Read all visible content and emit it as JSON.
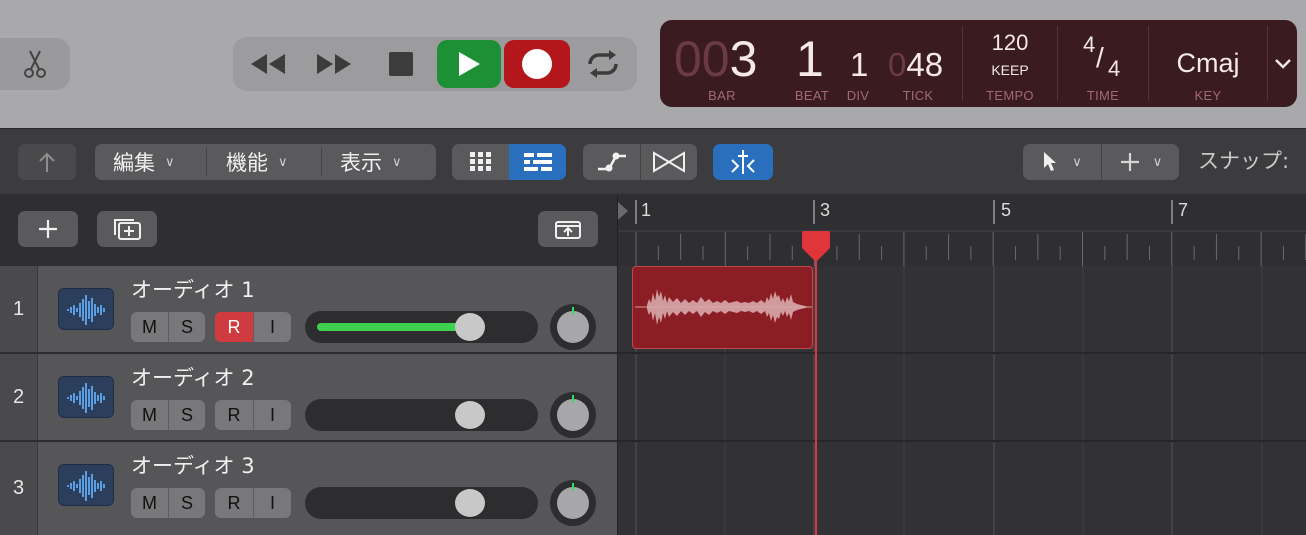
{
  "control_bar": {
    "lcd": {
      "bar_prefix": "00",
      "bar": "3",
      "beat": "1",
      "div": "1",
      "tick_prefix": "0",
      "tick": "48",
      "tempo": "120",
      "tempo_mode": "KEEP",
      "time_num": "4",
      "time_den": "4",
      "key": "Cmaj",
      "labels": {
        "bar": "BAR",
        "beat": "BEAT",
        "div": "DIV",
        "tick": "TICK",
        "tempo": "TEMPO",
        "time": "TIME",
        "key": "KEY"
      }
    },
    "colors": {
      "play": "#1d8f35",
      "record": "#b3171c",
      "lcd_bg": "#3a1c20"
    }
  },
  "toolbar": {
    "menus": [
      {
        "label": "編集"
      },
      {
        "label": "機能"
      },
      {
        "label": "表示"
      }
    ],
    "snap_label": "スナップ:"
  },
  "ruler": {
    "bar_labels": [
      "1",
      "3",
      "5",
      "7"
    ]
  },
  "tracks": [
    {
      "number": "1",
      "name": "オーディオ 1",
      "m": "M",
      "s": "S",
      "r": "R",
      "i": "I",
      "record_enabled": true,
      "volume_level": 0.78
    },
    {
      "number": "2",
      "name": "オーディオ 2",
      "m": "M",
      "s": "S",
      "r": "R",
      "i": "I",
      "record_enabled": false,
      "volume_level": 0.72
    },
    {
      "number": "3",
      "name": "オーディオ 3",
      "m": "M",
      "s": "S",
      "r": "R",
      "i": "I",
      "record_enabled": false,
      "volume_level": 0.72
    }
  ],
  "icons": [
    "scissors-icon",
    "rewind-icon",
    "fast-forward-icon",
    "stop-icon",
    "play-icon",
    "record-icon",
    "cycle-icon",
    "lcd-menu-chevron-icon",
    "up-arrow-icon",
    "grid-view-icon",
    "list-view-icon",
    "automation-icon",
    "flex-icon",
    "catch-icon",
    "pointer-tool-icon",
    "crosshair-tool-icon",
    "add-track-icon",
    "duplicate-track-icon",
    "track-header-icon",
    "waveform-icon",
    "playhead-icon"
  ]
}
